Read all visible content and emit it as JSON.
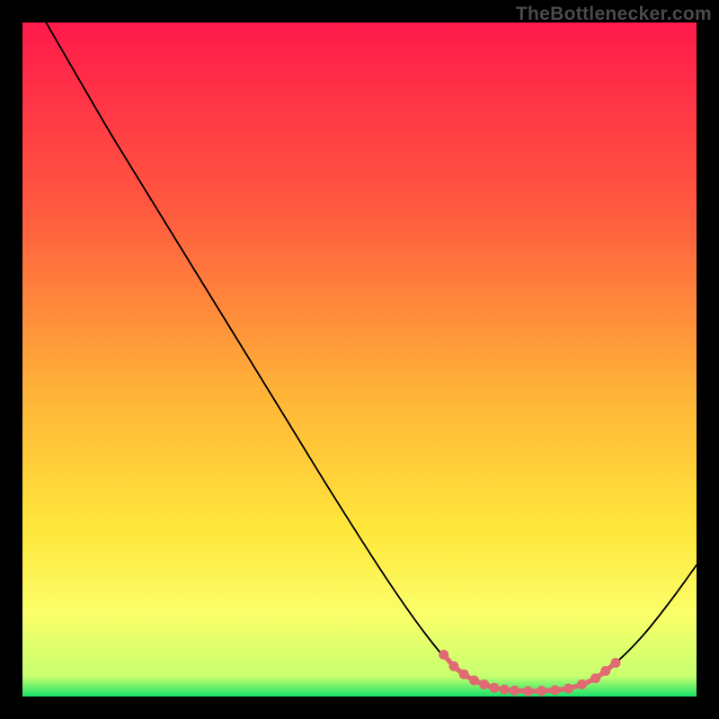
{
  "watermark": "TheBottlenecker.com",
  "chart_data": {
    "type": "line",
    "title": "",
    "xlabel": "",
    "ylabel": "",
    "xlim": [
      0,
      100
    ],
    "ylim": [
      0,
      100
    ],
    "background_gradient": {
      "stops": [
        {
          "offset": 0,
          "color": "#ff1a4b"
        },
        {
          "offset": 28,
          "color": "#ff5a3f"
        },
        {
          "offset": 55,
          "color": "#ffb338"
        },
        {
          "offset": 75,
          "color": "#ffe63a"
        },
        {
          "offset": 88,
          "color": "#faff6a"
        },
        {
          "offset": 97,
          "color": "#c7ff6e"
        },
        {
          "offset": 100,
          "color": "#19e36b"
        }
      ]
    },
    "series": [
      {
        "name": "bottleneck-curve",
        "color": "#000000",
        "width": 1.9,
        "points": [
          {
            "x": 3.5,
            "y": 100.0
          },
          {
            "x": 9.0,
            "y": 90.5
          },
          {
            "x": 14.0,
            "y": 82.0
          },
          {
            "x": 22.0,
            "y": 69.0
          },
          {
            "x": 30.0,
            "y": 56.0
          },
          {
            "x": 38.0,
            "y": 43.0
          },
          {
            "x": 46.0,
            "y": 30.0
          },
          {
            "x": 54.0,
            "y": 17.5
          },
          {
            "x": 60.0,
            "y": 9.0
          },
          {
            "x": 64.0,
            "y": 4.5
          },
          {
            "x": 68.0,
            "y": 2.0
          },
          {
            "x": 72.0,
            "y": 1.0
          },
          {
            "x": 76.0,
            "y": 0.8
          },
          {
            "x": 80.0,
            "y": 1.0
          },
          {
            "x": 84.0,
            "y": 2.2
          },
          {
            "x": 88.0,
            "y": 5.0
          },
          {
            "x": 92.0,
            "y": 9.0
          },
          {
            "x": 96.0,
            "y": 14.0
          },
          {
            "x": 100.0,
            "y": 19.5
          }
        ]
      },
      {
        "name": "highlight-dots",
        "color": "#e06a72",
        "radius": 5.5,
        "line_width": 5.5,
        "points": [
          {
            "x": 62.5,
            "y": 6.2
          },
          {
            "x": 64.0,
            "y": 4.5
          },
          {
            "x": 65.5,
            "y": 3.3
          },
          {
            "x": 67.0,
            "y": 2.4
          },
          {
            "x": 68.5,
            "y": 1.8
          },
          {
            "x": 70.0,
            "y": 1.3
          },
          {
            "x": 71.5,
            "y": 1.05
          },
          {
            "x": 73.0,
            "y": 0.9
          },
          {
            "x": 75.0,
            "y": 0.8
          },
          {
            "x": 77.0,
            "y": 0.85
          },
          {
            "x": 79.0,
            "y": 0.95
          },
          {
            "x": 81.0,
            "y": 1.2
          },
          {
            "x": 83.0,
            "y": 1.8
          },
          {
            "x": 85.0,
            "y": 2.7
          },
          {
            "x": 86.5,
            "y": 3.8
          },
          {
            "x": 88.0,
            "y": 5.0
          }
        ]
      }
    ]
  }
}
